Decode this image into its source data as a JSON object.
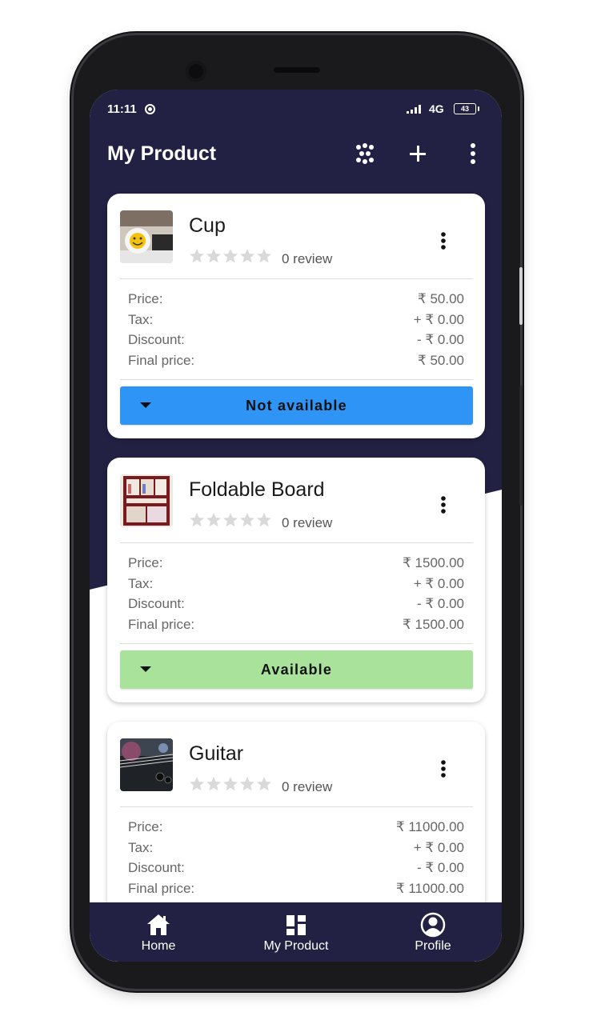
{
  "status_bar": {
    "time": "11:11",
    "signal": "∶∶∶l",
    "network": "4G",
    "battery": "43"
  },
  "app_bar": {
    "title": "My Product"
  },
  "products": [
    {
      "name": "Cup",
      "review": "0 review",
      "price_label": "Price:",
      "price": "₹ 50.00",
      "tax_label": "Tax:",
      "tax": "+ ₹ 0.00",
      "discount_label": "Discount:",
      "discount": "- ₹ 0.00",
      "final_label": "Final price:",
      "final": "₹ 50.00",
      "status": "Not available",
      "status_color": "#2e95f6"
    },
    {
      "name": "Foldable Board",
      "review": "0 review",
      "price_label": "Price:",
      "price": "₹ 1500.00",
      "tax_label": "Tax:",
      "tax": "+ ₹ 0.00",
      "discount_label": "Discount:",
      "discount": "- ₹ 0.00",
      "final_label": "Final price:",
      "final": "₹ 1500.00",
      "status": "Available",
      "status_color": "#a9e29a"
    },
    {
      "name": "Guitar",
      "review": "0 review",
      "price_label": "Price:",
      "price": "₹ 11000.00",
      "tax_label": "Tax:",
      "tax": "+ ₹ 0.00",
      "discount_label": "Discount:",
      "discount": "- ₹ 0.00",
      "final_label": "Final price:",
      "final": "₹ 11000.00"
    }
  ],
  "bottom_nav": [
    {
      "label": "Home",
      "icon": "home-icon"
    },
    {
      "label": "My Product",
      "icon": "dashboard-icon"
    },
    {
      "label": "Profile",
      "icon": "profile-icon"
    }
  ],
  "colors": {
    "primary": "#222143",
    "available": "#a9e29a",
    "not_available": "#2e95f6"
  }
}
